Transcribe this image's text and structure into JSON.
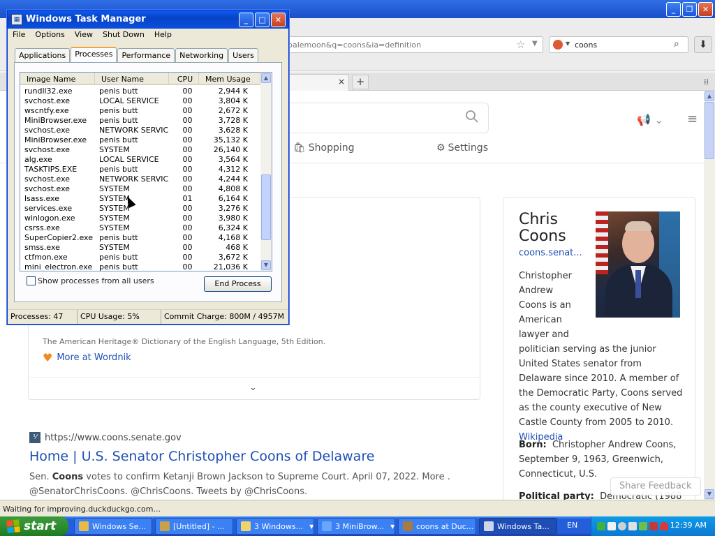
{
  "browser": {
    "title": "...",
    "url": "palemoon&q=coons&ia=definition",
    "search_value": "coons",
    "status_text": "Waiting for improving.duckduckgo.com...",
    "tab_close": "×",
    "new_tab": "+"
  },
  "ddg": {
    "nav_shopping": "Shopping",
    "nav_settings": "Settings",
    "dictionary_source": "The American Heritage® Dictionary of the English Language, 5th Edition.",
    "more_at": "More at Wordnik",
    "result": {
      "url": "https://www.coons.senate.gov",
      "title": "Home | U.S. Senator Christopher Coons of Delaware",
      "snippet_pre": "Sen. ",
      "snippet_bold": "Coons",
      "snippet_post": " votes to confirm Ketanji Brown Jackson to Supreme Court. April 07, 2022. More . @SenatorChrisCoons. @ChrisCoons. Tweets by @ChrisCoons."
    },
    "info": {
      "name": "Chris Coons",
      "link": "coons.senat...",
      "desc_lines": [
        "Christopher",
        "Andrew",
        "Coons is an",
        "American",
        "lawyer and"
      ],
      "desc_rest": "politician serving as the junior United States senator from Delaware since 2010. A member of the Democratic Party, Coons served as the county executive of New Castle County from 2005 to 2010.",
      "wiki": "Wikipedia",
      "born_label": "Born:",
      "born_value": "Christopher Andrew Coons, September 9, 1963, Greenwich, Connecticut, U.S.",
      "party_label": "Political party:",
      "party_value": "Democratic (1988"
    },
    "share_feedback": "Share Feedback"
  },
  "taskman": {
    "title": "Windows Task Manager",
    "menu": [
      "File",
      "Options",
      "View",
      "Shut Down",
      "Help"
    ],
    "tabs": [
      "Applications",
      "Processes",
      "Performance",
      "Networking",
      "Users"
    ],
    "active_tab": "Processes",
    "columns": [
      "Image Name",
      "User Name",
      "CPU",
      "Mem Usage"
    ],
    "processes": [
      {
        "name": "rundll32.exe",
        "user": "penis butt",
        "cpu": "00",
        "mem": "2,944 K"
      },
      {
        "name": "svchost.exe",
        "user": "LOCAL SERVICE",
        "cpu": "00",
        "mem": "3,804 K"
      },
      {
        "name": "wscntfy.exe",
        "user": "penis butt",
        "cpu": "00",
        "mem": "2,672 K"
      },
      {
        "name": "MiniBrowser.exe",
        "user": "penis butt",
        "cpu": "00",
        "mem": "3,728 K"
      },
      {
        "name": "svchost.exe",
        "user": "NETWORK SERVICE",
        "cpu": "00",
        "mem": "3,628 K"
      },
      {
        "name": "MiniBrowser.exe",
        "user": "penis butt",
        "cpu": "00",
        "mem": "35,132 K"
      },
      {
        "name": "svchost.exe",
        "user": "SYSTEM",
        "cpu": "00",
        "mem": "26,140 K"
      },
      {
        "name": "alg.exe",
        "user": "LOCAL SERVICE",
        "cpu": "00",
        "mem": "3,564 K"
      },
      {
        "name": "TASKTIPS.EXE",
        "user": "penis butt",
        "cpu": "00",
        "mem": "4,312 K"
      },
      {
        "name": "svchost.exe",
        "user": "NETWORK SERVICE",
        "cpu": "00",
        "mem": "4,244 K"
      },
      {
        "name": "svchost.exe",
        "user": "SYSTEM",
        "cpu": "00",
        "mem": "4,808 K"
      },
      {
        "name": "lsass.exe",
        "user": "SYSTEM",
        "cpu": "01",
        "mem": "6,164 K"
      },
      {
        "name": "services.exe",
        "user": "SYSTEM",
        "cpu": "00",
        "mem": "3,276 K"
      },
      {
        "name": "winlogon.exe",
        "user": "SYSTEM",
        "cpu": "00",
        "mem": "3,980 K"
      },
      {
        "name": "csrss.exe",
        "user": "SYSTEM",
        "cpu": "00",
        "mem": "6,324 K"
      },
      {
        "name": "SuperCopier2.exe",
        "user": "penis butt",
        "cpu": "00",
        "mem": "4,168 K"
      },
      {
        "name": "smss.exe",
        "user": "SYSTEM",
        "cpu": "00",
        "mem": "468 K"
      },
      {
        "name": "ctfmon.exe",
        "user": "penis butt",
        "cpu": "00",
        "mem": "3,672 K"
      },
      {
        "name": "mini_electron.exe",
        "user": "penis butt",
        "cpu": "00",
        "mem": "21,036 K"
      }
    ],
    "show_all_label": "Show processes from all users",
    "end_process": "End Process",
    "status": {
      "processes": "Processes: 47",
      "cpu": "CPU Usage: 5%",
      "commit": "Commit Charge: 800M / 4957M"
    }
  },
  "taskbar": {
    "start": "start",
    "buttons": [
      {
        "label": "Windows Se...",
        "icon_color": "#e8b84a",
        "arrow": false
      },
      {
        "label": "[Untitled] - ...",
        "icon_color": "#c9a14b",
        "arrow": false
      },
      {
        "label": "3 Windows...",
        "icon_color": "#f1d36b",
        "arrow": true
      },
      {
        "label": "3 MiniBrow...",
        "icon_color": "#6aa5ff",
        "arrow": true
      },
      {
        "label": "coons at Duc...",
        "icon_color": "#a67b3d",
        "arrow": false
      },
      {
        "label": "Windows Ta...",
        "icon_color": "#cfd8ea",
        "arrow": false
      }
    ],
    "lang": "EN",
    "clock": "12:39 AM"
  },
  "colors": {
    "link": "#1e4fb4",
    "xp_blue": "#245edb",
    "start_green": "#2f8d2f"
  }
}
